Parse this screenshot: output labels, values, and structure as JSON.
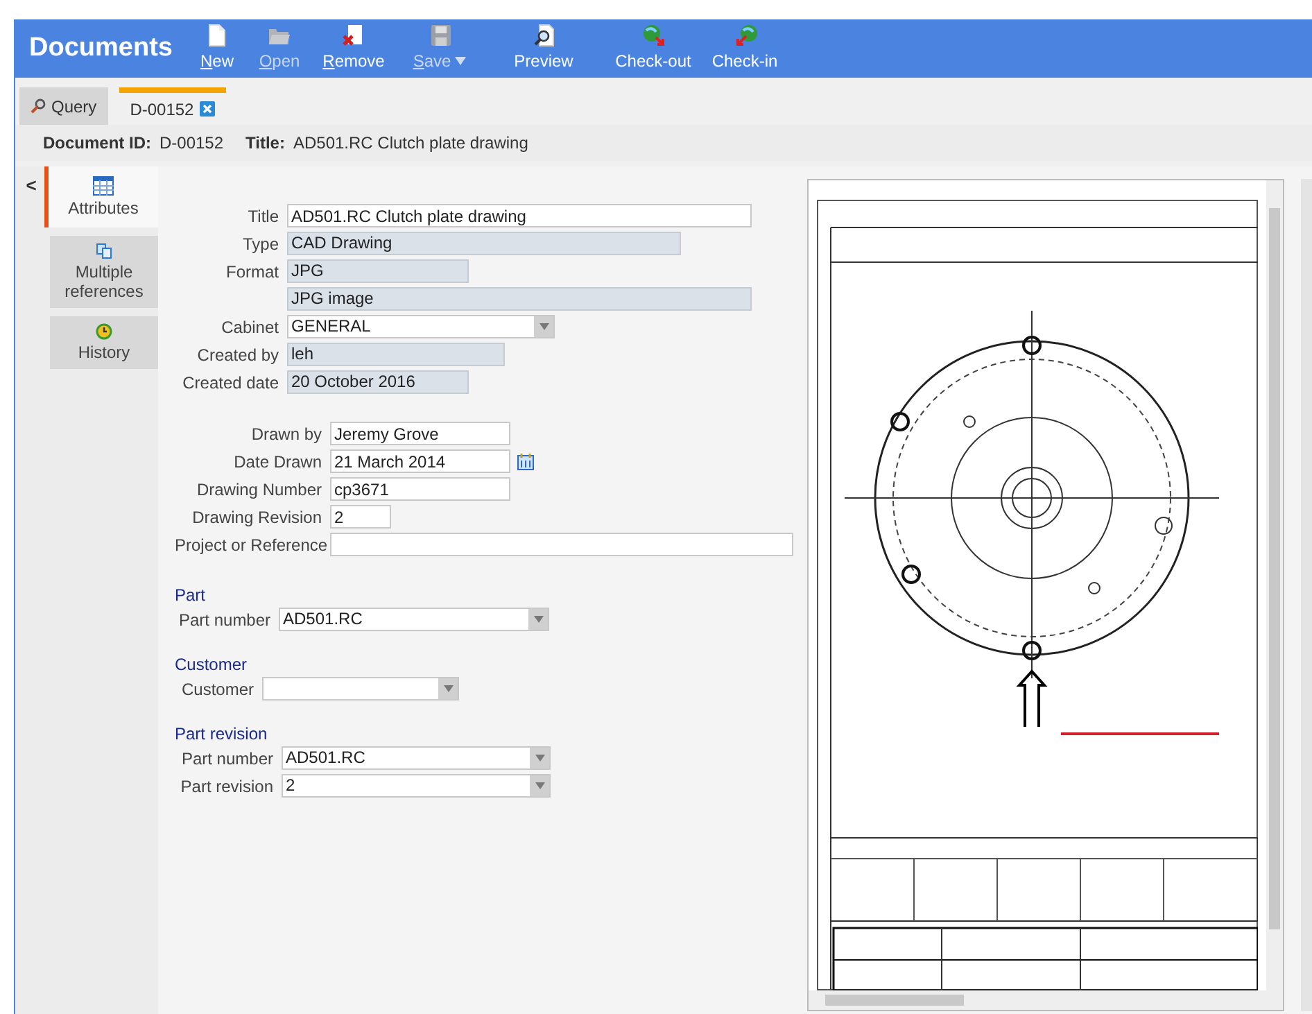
{
  "header": {
    "title": "Documents",
    "toolbar": [
      {
        "kind": "new",
        "label": "New",
        "mnemonic": true,
        "disabled": false,
        "dropdown": false
      },
      {
        "kind": "open",
        "label": "Open",
        "mnemonic": true,
        "disabled": true,
        "dropdown": false
      },
      {
        "kind": "remove",
        "label": "Remove",
        "mnemonic": true,
        "disabled": false,
        "dropdown": false
      },
      {
        "kind": "save",
        "label": "Save",
        "mnemonic": true,
        "disabled": true,
        "dropdown": true
      },
      {
        "kind": "preview",
        "label": "Preview",
        "mnemonic": false,
        "disabled": false,
        "dropdown": false
      },
      {
        "kind": "checkout",
        "label": "Check-out",
        "mnemonic": false,
        "disabled": false,
        "dropdown": false
      },
      {
        "kind": "checkin",
        "label": "Check-in",
        "mnemonic": false,
        "disabled": false,
        "dropdown": false
      }
    ]
  },
  "tabs": [
    {
      "label": "Query",
      "kind": "query",
      "selected": false,
      "closable": false
    },
    {
      "label": "D-00152",
      "kind": "document",
      "selected": true,
      "closable": true
    }
  ],
  "doc_info": {
    "id_label": "Document ID:",
    "id": "D-00152",
    "title_label": "Title:",
    "title": "AD501.RC Clutch plate drawing"
  },
  "side_panel": {
    "collapse": "<",
    "items": [
      {
        "label": "Attributes",
        "kind": "attributes",
        "selected": true
      },
      {
        "label": "Multiple references",
        "kind": "references",
        "selected": false
      },
      {
        "label": "History",
        "kind": "history",
        "selected": false
      }
    ]
  },
  "groups": [
    {
      "fields": [
        {
          "label": "Title",
          "kind": "text",
          "value": "AD501.RC Clutch plate drawing"
        },
        {
          "label": "Type",
          "kind": "readonly",
          "value": "CAD Drawing"
        },
        {
          "label": "Format",
          "kind": "readonly",
          "value": "JPG"
        },
        {
          "kind": "readonly",
          "value": "JPG image"
        },
        {
          "label": "Cabinet",
          "kind": "select",
          "value": "GENERAL"
        },
        {
          "label": "Created by",
          "kind": "readonly",
          "value": "leh"
        },
        {
          "label": "Created date",
          "kind": "readonly",
          "value": "20 October 2016"
        }
      ]
    },
    {
      "fields": [
        {
          "label": "Drawn by",
          "kind": "text",
          "value": "Jeremy Grove"
        },
        {
          "label": "Date Drawn",
          "kind": "date",
          "value": "21 March 2014"
        },
        {
          "label": "Drawing Number",
          "kind": "text",
          "value": "cp3671"
        },
        {
          "label": "Drawing Revision",
          "kind": "text",
          "value": "2"
        },
        {
          "label": "Project or Reference",
          "kind": "text"
        }
      ]
    },
    {
      "heading": "Part",
      "fields": [
        {
          "label": "Part number",
          "kind": "select",
          "value": "AD501.RC"
        }
      ]
    },
    {
      "heading": "Customer",
      "fields": [
        {
          "label": "Customer",
          "kind": "select"
        }
      ]
    },
    {
      "heading": "Part revision",
      "fields": [
        {
          "label": "Part number",
          "kind": "select",
          "value": "AD501.RC"
        },
        {
          "label": "Part revision",
          "kind": "select",
          "value": "2"
        }
      ]
    }
  ]
}
